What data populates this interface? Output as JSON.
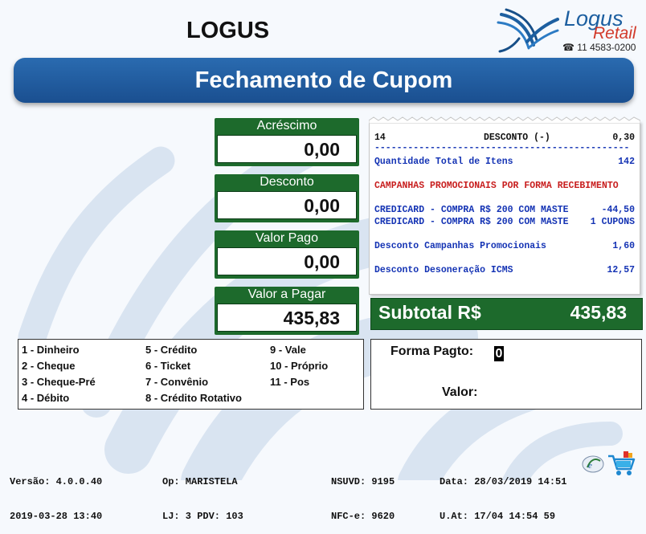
{
  "header": {
    "app_title": "LOGUS",
    "brand": {
      "word1": "Logus",
      "word2": "Retail",
      "phone": "☎ 11 4583-0200"
    }
  },
  "banner": {
    "title": "Fechamento de Cupom"
  },
  "fields": [
    {
      "label": "Acréscimo",
      "value": "0,00"
    },
    {
      "label": "Desconto",
      "value": "0,00"
    },
    {
      "label": "Valor Pago",
      "value": "0,00"
    },
    {
      "label": "Valor a Pagar",
      "value": "435,83"
    }
  ],
  "receipt": {
    "top_line": {
      "item": "14",
      "desc": "DESCONTO (-)",
      "value": "0,30"
    },
    "separator": "----------------------------------------------",
    "qtd_label": "Quantidade Total de Itens",
    "qtd_value": "142",
    "campanhas_title": "CAMPANHAS PROMOCIONAIS POR FORMA RECEBIMENTO",
    "campanha_lines": [
      {
        "label": "CREDICARD - COMPRA R$ 200 COM MASTE",
        "value": "-44,50"
      },
      {
        "label": "CREDICARD - COMPRA R$ 200 COM MASTE",
        "value": "1 CUPONS"
      }
    ],
    "desc_campanhas_label": "Desconto Campanhas Promocionais",
    "desc_campanhas_value": "1,60",
    "desc_deson_label": "Desconto Desoneração ICMS",
    "desc_deson_value": "12,57"
  },
  "subtotal": {
    "label": "Subtotal R$",
    "value": "435,83"
  },
  "payment_methods": {
    "col1": [
      "1 - Dinheiro",
      "2 - Cheque",
      "3 - Cheque-Pré",
      "4 - Débito"
    ],
    "col2": [
      "5 - Crédito",
      "6 - Ticket",
      "7 - Convênio",
      "8 - Crédito Rotativo"
    ],
    "col3": [
      "9 - Vale",
      "10 - Próprio",
      "11 - Pos"
    ]
  },
  "forma_pagto": {
    "label": "Forma Pagto:",
    "value": "0",
    "valor_label": "Valor:"
  },
  "status": {
    "versao": "Versão: 4.0.0.40",
    "build_date": "2019-03-28 13:40",
    "op": "Op: MARISTELA",
    "lj_pdv": "LJ: 3 PDV: 103",
    "nsuvd": "NSUVD: 9195",
    "nfce": "NFC-e: 9620",
    "data": "Data: 28/03/2019 14:51",
    "uat": "U.At: 17/04 14:54 59"
  },
  "colors": {
    "banner": "#1a5597",
    "green_panel": "#1d6a2c",
    "receipt_blue": "#1433b4",
    "receipt_red": "#c81e1e"
  }
}
